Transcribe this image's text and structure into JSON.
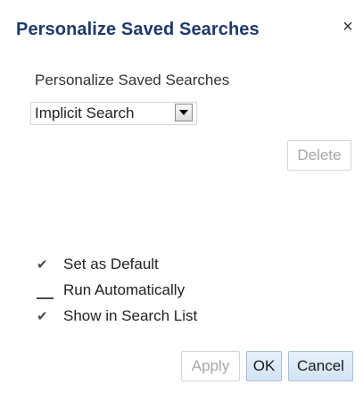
{
  "dialog": {
    "title": "Personalize Saved Searches",
    "close_icon": "×"
  },
  "saved_search": {
    "label": "Personalize Saved Searches",
    "selected_value": "Implicit Search"
  },
  "buttons": {
    "delete": "Delete",
    "apply": "Apply",
    "ok": "OK",
    "cancel": "Cancel"
  },
  "options": [
    {
      "label": "Set as Default",
      "checked": true
    },
    {
      "label": "Run Automatically",
      "checked": false
    },
    {
      "label": "Show in Search List",
      "checked": true
    }
  ],
  "icons": {
    "check": "✔",
    "close": "close-icon",
    "dropdown": "chevron-down-icon"
  },
  "colors": {
    "title": "#1e3a6b",
    "button_active_bg": "#dbe8f6",
    "button_disabled_text": "#a7a7a7"
  }
}
